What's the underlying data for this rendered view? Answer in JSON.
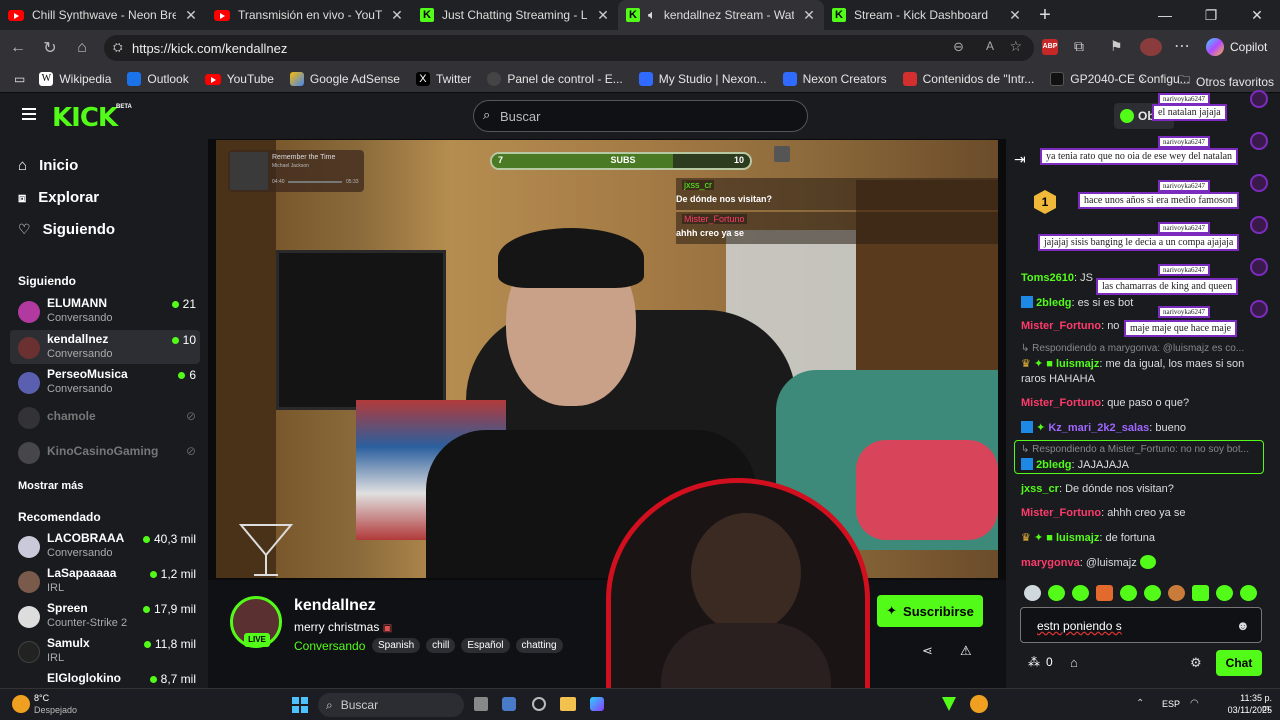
{
  "browser": {
    "tabs": [
      {
        "label": "Chill Synthwave - Neon Breeze by",
        "icon": "youtube"
      },
      {
        "label": "Transmisión en vivo - YouTube Stu",
        "icon": "youtube"
      },
      {
        "label": "Just Chatting Streaming - Live Str",
        "icon": "kick"
      },
      {
        "label": "kendallnez Stream - Watch L",
        "icon": "kick"
      },
      {
        "label": "Stream - Kick Dashboard",
        "icon": "kick"
      }
    ],
    "url": "https://kick.com/kendallnez",
    "copilot_label": "Copilot",
    "bookmarks": [
      "Wikipedia",
      "Outlook",
      "YouTube",
      "Google AdSense",
      "Twitter",
      "Panel de control - E...",
      "My Studio | Nexon...",
      "Nexon Creators",
      "Contenidos de \"Intr...",
      "GP2040-CE Configu..."
    ],
    "other_bookmarks": "Otros favoritos"
  },
  "kick": {
    "logo": "KICK",
    "beta": "BETA",
    "search_placeholder": "Buscar",
    "obtain_label": "Obt",
    "nav": {
      "home": "Inicio",
      "explore": "Explorar",
      "following": "Siguiendo"
    },
    "following_header": "Siguiendo",
    "following": [
      {
        "name": "ELUMANN",
        "category": "Conversando",
        "viewers": "21",
        "online": true
      },
      {
        "name": "kendallnez",
        "category": "Conversando",
        "viewers": "10",
        "online": true
      },
      {
        "name": "PerseoMusica",
        "category": "Conversando",
        "viewers": "6",
        "online": true
      },
      {
        "name": "chamole",
        "category": "",
        "viewers": "",
        "online": false
      },
      {
        "name": "KinoCasinoGaming",
        "category": "",
        "viewers": "",
        "online": false
      }
    ],
    "show_more": "Mostrar más",
    "recommended_header": "Recomendado",
    "recommended": [
      {
        "name": "LACOBRAAA",
        "category": "Conversando",
        "viewers": "40,3 mil"
      },
      {
        "name": "LaSapaaaaa",
        "category": "IRL",
        "viewers": "1,2 mil"
      },
      {
        "name": "Spreen",
        "category": "Counter-Strike 2",
        "viewers": "17,9 mil"
      },
      {
        "name": "Samulx",
        "category": "IRL",
        "viewers": "11,8 mil"
      },
      {
        "name": "ElGloglokino",
        "category": "",
        "viewers": "8,7 mil"
      }
    ]
  },
  "overlay": {
    "subs_goal": {
      "current": "7",
      "label": "SUBS",
      "target": "10",
      "progress": 0.7
    },
    "song_title": "Remember the Time",
    "song_artist": "Michael Jackson",
    "song_time_start": "04:40",
    "song_time_end": "05:33",
    "chat_overlay": [
      {
        "user": "jxss_cr",
        "text": "De dónde nos visitan?"
      },
      {
        "user": "Mister_Fortuno",
        "text": "ahhh creo ya se"
      }
    ]
  },
  "stream": {
    "channel": "kendallnez",
    "title": "merry christmas",
    "category": "Conversando",
    "live_badge": "LIVE",
    "tags": [
      "Spanish",
      "chill",
      "Español",
      "chatting"
    ],
    "subscribe_label": "Suscribirse"
  },
  "chat": {
    "tts_messages": [
      "el natalan jajaja",
      "ya tenia rato que no oia de ese wey del natalan",
      "hace unos años si era medio famoson",
      "jajajaj sisis banging le decia a un compa ajajaja",
      "las chamarras de king and queen",
      "maje maje que hace maje"
    ],
    "tts_user": "narivoyka6247",
    "pinned_rank": "1",
    "messages": [
      {
        "user": "Toms2610",
        "text": "JS",
        "color": "#53fc18"
      },
      {
        "user": "2bledg",
        "text": "es si es bot",
        "color": "#53fc18"
      },
      {
        "user": "Mister_Fortuno",
        "text": "no",
        "color": "#ff3b6b"
      },
      {
        "reply": "Respondiendo a marygonva: @luismajz es co...",
        "user": "luismajz",
        "text": "me da igual, los maes si son raros HAHAHA",
        "color": "#53fc18"
      },
      {
        "user": "Mister_Fortuno",
        "text": "que paso o que?",
        "color": "#ff3b6b"
      },
      {
        "user": "Kz_mari_2k2_salas",
        "text": "bueno",
        "color": "#a066ff"
      },
      {
        "reply": "Respondiendo a Mister_Fortuno: no no soy bot...",
        "user": "2bledg",
        "text": "JAJAJAJA",
        "color": "#53fc18"
      },
      {
        "user": "jxss_cr",
        "text": "De dónde nos visitan?",
        "color": "#53fc18"
      },
      {
        "user": "Mister_Fortuno",
        "text": "ahhh creo ya se",
        "color": "#ff3b6b"
      },
      {
        "user": "luismajz",
        "text": "de fortuna",
        "color": "#53fc18"
      },
      {
        "user": "marygonva",
        "text": "@luismajz",
        "color": "#ff3b6b"
      }
    ],
    "input_value": "estn poniendo s",
    "points": "0",
    "send_label": "Chat"
  },
  "taskbar": {
    "weather_temp": "8°C",
    "weather_desc": "Despejado",
    "search_label": "Buscar",
    "lang": "ESP",
    "time": "11:35 p. m.",
    "date": "03/11/2025"
  },
  "colors": {
    "kick_green": "#53fc18",
    "bg": "#0b0b0d",
    "panel": "#191b1f"
  }
}
